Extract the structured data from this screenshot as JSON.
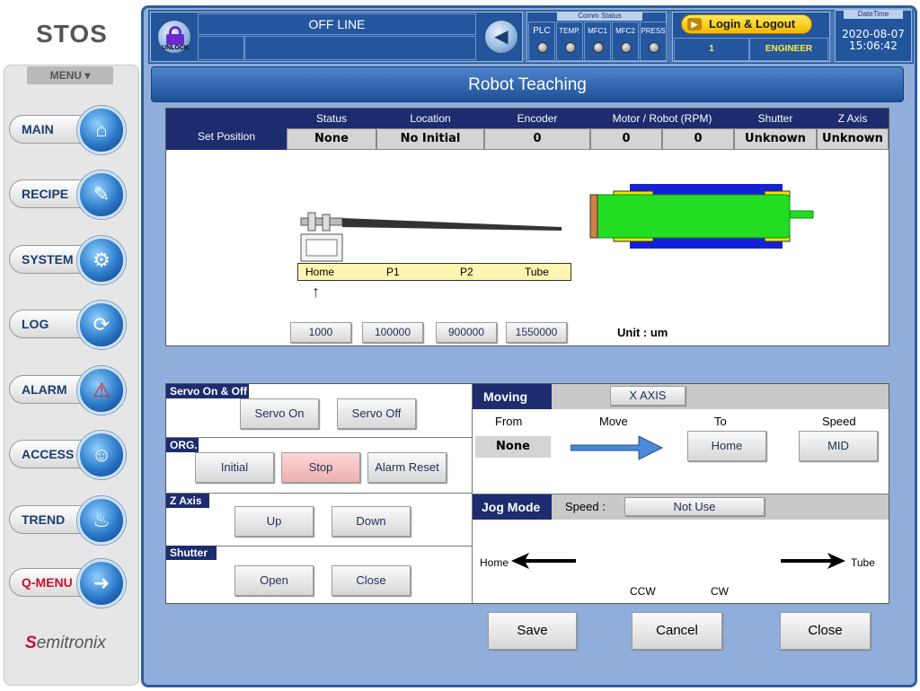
{
  "sidebar": {
    "logo": "STOS",
    "menu_label": "MENU",
    "menu_arrow": "▾",
    "items": [
      {
        "label": "MAIN",
        "icon": "home-icon",
        "glyph": "⌂"
      },
      {
        "label": "RECIPE",
        "icon": "document-icon",
        "glyph": "✎"
      },
      {
        "label": "SYSTEM",
        "icon": "gears-icon",
        "glyph": "⚙"
      },
      {
        "label": "LOG",
        "icon": "log-icon",
        "glyph": "⟳"
      },
      {
        "label": "ALARM",
        "icon": "warning-icon",
        "glyph": "⚠"
      },
      {
        "label": "ACCESS",
        "icon": "user-icon",
        "glyph": "☺"
      },
      {
        "label": "TREND",
        "icon": "chart-icon",
        "glyph": "♨"
      },
      {
        "label": "Q-MENU",
        "icon": "exit-door-icon",
        "glyph": "➜"
      }
    ],
    "brand_s": "S",
    "brand_rest": "emitronix"
  },
  "header": {
    "unlock_label": "UNLOCK",
    "status": "OFF LINE",
    "comm_status_title": "Comm Status",
    "comm": [
      "PLC",
      "TEMP.",
      "MFC1",
      "MFC2",
      "PRESS"
    ],
    "login_label": "Login & Logout",
    "user_level": "1",
    "user_name": "ENGINEER",
    "datetime_title": "DateTime",
    "date": "2020-08-07",
    "time": "15:06:42"
  },
  "page_title": "Robot Teaching",
  "position": {
    "set_position_label": "Set Position",
    "headers": {
      "status": "Status",
      "location": "Location",
      "encoder": "Encoder",
      "motor": "Motor / Robot (RPM)",
      "shutter": "Shutter",
      "zaxis": "Z Axis"
    },
    "values": {
      "status": "None",
      "location": "No Initial",
      "encoder": "0",
      "motor": "0",
      "robot": "0",
      "shutter": "Unknown",
      "zaxis": "Unknown"
    },
    "track_labels": [
      "Home",
      "P1",
      "P2",
      "Tube"
    ],
    "presets": [
      "1000",
      "100000",
      "900000",
      "1550000"
    ],
    "unit_label": "Unit : um"
  },
  "controls": {
    "servo_title": "Servo On & Off",
    "servo_on": "Servo On",
    "servo_off": "Servo Off",
    "org_title": "ORG.",
    "initial": "Initial",
    "stop": "Stop",
    "alarm_reset": "Alarm Reset",
    "zaxis_title": "Z Axis",
    "up": "Up",
    "down": "Down",
    "shutter_title": "Shutter",
    "open": "Open",
    "close": "Close",
    "moving_title": "Moving",
    "axis_button": "X AXIS",
    "from_label": "From",
    "move_label": "Move",
    "to_label": "To",
    "speed_label": "Speed",
    "from_value": "None",
    "to_value": "Home",
    "speed_value": "MID",
    "jog_title": "Jog Mode",
    "jog_speed_label": "Speed :",
    "jog_speed_value": "Not Use",
    "jog_home": "Home",
    "jog_tube": "Tube",
    "ccw": "CCW",
    "cw": "CW"
  },
  "footer": {
    "save": "Save",
    "cancel": "Cancel",
    "close": "Close"
  },
  "colors": {
    "frame": "#2c5ea0",
    "table_header": "#1c2c6e",
    "stop_button": "#f4c2c2",
    "track": "#fdf6b0",
    "tube_green": "#22dd22",
    "tube_blue": "#1520d8",
    "tube_yellow": "#f2e400"
  }
}
